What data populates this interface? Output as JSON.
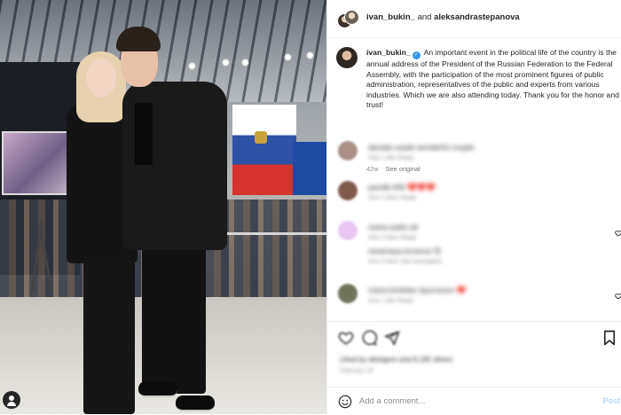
{
  "header": {
    "username": "ivan_bukin_",
    "connector": "and",
    "collaborator": "aleksandrastepanova"
  },
  "caption": {
    "username": "ivan_bukin_",
    "text": "An important event in the political life of the country is the annual address of the President of the Russian Federation to the Federal Assembly, with the participation of the most prominent figures of public administration, representatives of the public and experts from various industries. Which we are also attending today. Thank you for the honor and trust!",
    "age": "42w",
    "see_original": "See original"
  },
  "comments": [
    {
      "text": "darada.casab wonderful couple",
      "sub": "43w   1 like   Reply",
      "avatar_color": "#a98f86",
      "has_reply": false
    },
    {
      "text": "pavelk.009 ❤️❤️❤️",
      "sub": "42w   2 likes   Reply",
      "avatar_color": "#7e5a4c",
      "has_reply": false
    },
    {
      "text": "maria.sadm.all",
      "sub": "42w   3 likes   Reply",
      "avatar_color": "#e8c7f0",
      "has_reply": true
    },
    {
      "text": "renamaya.incarnut 😊",
      "sub": "41w   5 likes   See translation",
      "avatar_color": "#ffffff",
      "has_reply": false
    },
    {
      "text": "maria.fonfetter lipurnsoon ❤️",
      "sub": "41w   1 like   Reply",
      "avatar_color": "#6f735c",
      "has_reply": true
    }
  ],
  "actions": {
    "likes": "Liked by allohgern and 8,195 others",
    "date": "February 29"
  },
  "comment_box": {
    "placeholder": "Add a comment...",
    "post_label": "Post"
  },
  "icons": {
    "verified": "verified-badge-icon",
    "heart": "heart-icon",
    "comment": "comment-icon",
    "share": "share-icon",
    "bookmark": "bookmark-icon",
    "emoji": "emoji-icon",
    "photo_tag": "user-tag-icon"
  },
  "colors": {
    "verified_blue": "#3897f0",
    "text": "#262626",
    "muted": "#8e8e8e",
    "post_disabled": "#b7daf8"
  }
}
